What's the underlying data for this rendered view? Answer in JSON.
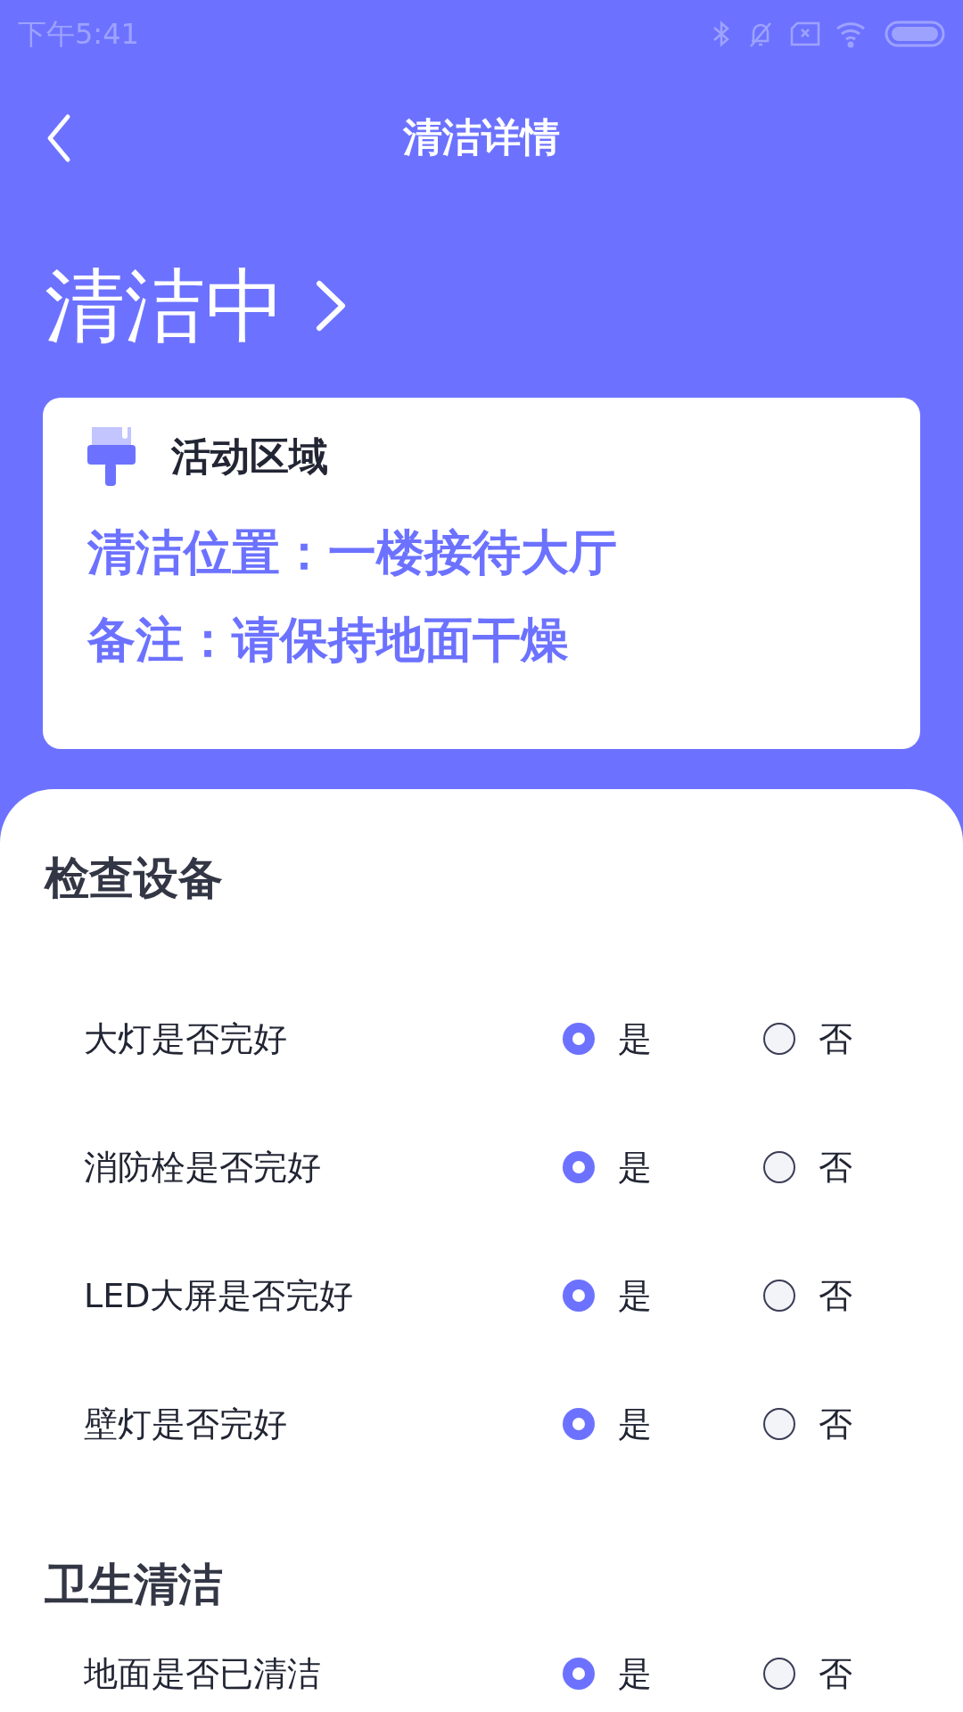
{
  "status_bar": {
    "time": "下午5:41"
  },
  "header": {
    "title": "清洁详情"
  },
  "status": {
    "label": "清洁中"
  },
  "card": {
    "title": "活动区域",
    "lines": [
      "清洁位置：一楼接待大厅",
      "备注：请保持地面干燥"
    ]
  },
  "sections": [
    {
      "title": "检查设备",
      "rows": [
        {
          "label": "大灯是否完好",
          "options": [
            {
              "label": "是",
              "selected": true
            },
            {
              "label": "否",
              "selected": false
            }
          ]
        },
        {
          "label": "消防栓是否完好",
          "options": [
            {
              "label": "是",
              "selected": true
            },
            {
              "label": "否",
              "selected": false
            }
          ]
        },
        {
          "label": "LED大屏是否完好",
          "options": [
            {
              "label": "是",
              "selected": true
            },
            {
              "label": "否",
              "selected": false
            }
          ]
        },
        {
          "label": "壁灯是否完好",
          "options": [
            {
              "label": "是",
              "selected": true
            },
            {
              "label": "否",
              "selected": false
            }
          ]
        }
      ]
    },
    {
      "title": "卫生清洁",
      "rows": [
        {
          "label": "地面是否已清洁",
          "options": [
            {
              "label": "是",
              "selected": true
            },
            {
              "label": "否",
              "selected": false
            }
          ]
        }
      ]
    }
  ]
}
